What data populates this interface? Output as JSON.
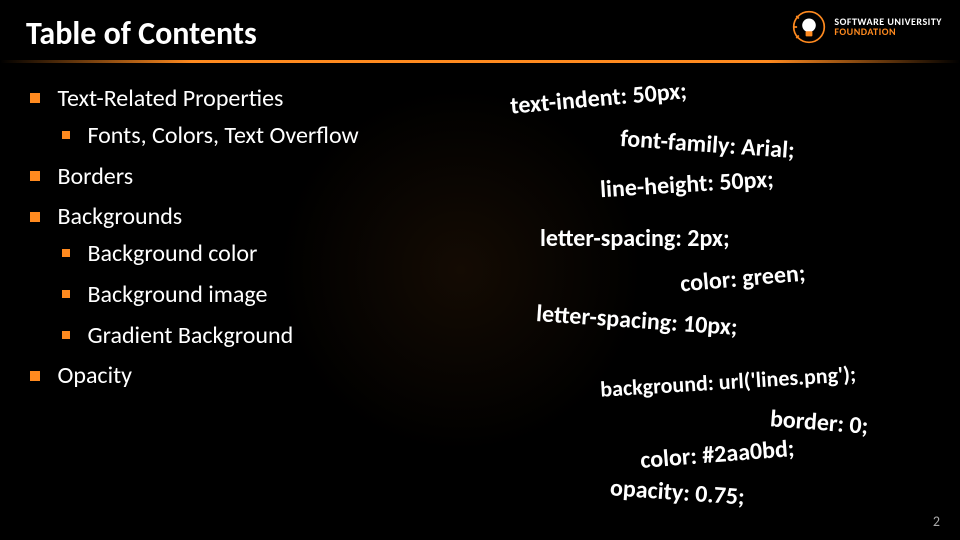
{
  "title": "Table of Contents",
  "logo": {
    "line1": "SOFTWARE UNIVERSITY",
    "line2": "FOUNDATION"
  },
  "toc": [
    {
      "label": "Text-Related Properties",
      "children": [
        {
          "label": "Fonts, Colors, Text Overflow"
        }
      ]
    },
    {
      "label": "Borders"
    },
    {
      "label": "Backgrounds",
      "children": [
        {
          "label": "Background color"
        },
        {
          "label": "Background image"
        },
        {
          "label": "Gradient Background"
        }
      ]
    },
    {
      "label": "Opacity"
    }
  ],
  "snippets": {
    "s1": "text-indent: 50px;",
    "s2": "font-family: Arial;",
    "s3": "line-height: 50px;",
    "s4": "letter-spacing: 2px;",
    "s5": "color: green;",
    "s6": "letter-spacing: 10px;",
    "s7": "background: url('lines.png');",
    "s8": "border: 0;",
    "s9": "color: #2aa0bd;",
    "s10": "opacity: 0.75;"
  },
  "page_number": "2"
}
